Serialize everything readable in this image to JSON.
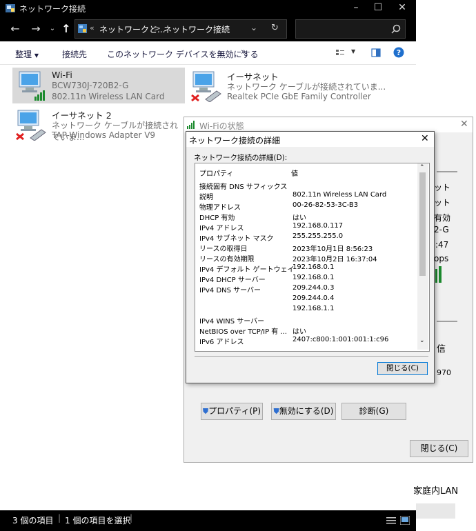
{
  "explorer": {
    "title": "ネットワーク接続",
    "address": {
      "prefix": "«",
      "part1": "ネットワークと...",
      "sep": ">",
      "part2": "ネットワーク接続"
    },
    "commands": {
      "organize": "整理",
      "connect": "接続先",
      "disable": "このネットワーク デバイスを無効にする",
      "more": "»"
    },
    "items": [
      {
        "name": "Wi-Fi",
        "line2": "BCW730J-720B2-G",
        "line3": "802.11n Wireless LAN Card"
      },
      {
        "name": "イーサネット",
        "line2": "ネットワーク ケーブルが接続されていま...",
        "line3": "Realtek PCIe GbE Family Controller"
      },
      {
        "name": "イーサネット 2",
        "line2": "ネットワーク ケーブルが接続されていま...",
        "line3": "TAP-Windows Adapter V9"
      }
    ],
    "status": {
      "count": "3 個の項目",
      "selected": "1 個の項目を選択"
    }
  },
  "wifi_status": {
    "title": "Wi-Fiの状態",
    "partial_right": [
      "ット",
      "ット",
      "有効",
      "2-G",
      ":47",
      "ops"
    ],
    "partial_right2": [
      "信",
      "970"
    ],
    "buttons": {
      "properties": "プロパティ(P)",
      "disable": "無効にする(D)",
      "diagnose": "診断(G)",
      "close": "閉じる(C)"
    },
    "behind_text": "家庭内LAN"
  },
  "details": {
    "title": "ネットワーク接続の詳細",
    "label": "ネットワーク接続の詳細(D):",
    "col_property": "プロパティ",
    "col_value": "値",
    "rows": [
      {
        "p": "接続固有 DNS サフィックス",
        "v": ""
      },
      {
        "p": "説明",
        "v": "802.11n Wireless LAN Card"
      },
      {
        "p": "物理アドレス",
        "v": "00-26-82-53-3C-B3"
      },
      {
        "p": "DHCP 有効",
        "v": "はい"
      },
      {
        "p": "IPv4 アドレス",
        "v": "192.168.0.117"
      },
      {
        "p": "IPv4 サブネット マスク",
        "v": "255.255.255.0"
      },
      {
        "p": "リースの取得日",
        "v": "2023年10月1日 8:56:23"
      },
      {
        "p": "リースの有効期限",
        "v": "2023年10月2日 16:37:04"
      },
      {
        "p": "IPv4 デフォルト ゲートウェイ",
        "v": "192.168.0.1"
      },
      {
        "p": "IPv4 DHCP サーバー",
        "v": "192.168.0.1"
      },
      {
        "p": "IPv4 DNS サーバー",
        "v": "209.244.0.3"
      },
      {
        "p": "",
        "v": "209.244.0.4"
      },
      {
        "p": "",
        "v": "192.168.1.1"
      },
      {
        "p": "IPv4 WINS サーバー",
        "v": ""
      },
      {
        "p": "NetBIOS over TCP/IP 有 ...",
        "v": "はい"
      },
      {
        "p": "IPv6 アドレス",
        "v": "2407:c800:1:001:001:1:c96"
      }
    ],
    "close": "閉じる(C)"
  }
}
